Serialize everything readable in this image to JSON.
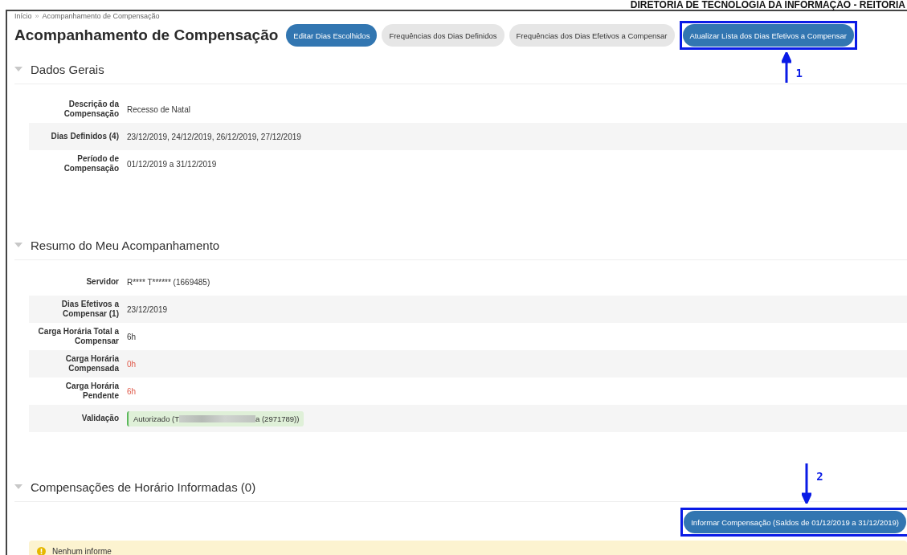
{
  "header": {
    "title": "DIRETORIA DE TECNOLOGIA DA INFORMAÇÃO - REITORIA"
  },
  "breadcrumb": [
    "Início",
    "»",
    "Acompanhamento de Compensação"
  ],
  "page_title": "Acompanhamento de Compensação",
  "actions": [
    {
      "label": "Editar Dias Escolhidos",
      "kind": "primary"
    },
    {
      "label": "Frequências dos Dias Definidos",
      "kind": "default"
    },
    {
      "label": "Frequências dos Dias Efetivos a Compensar",
      "kind": "default"
    },
    {
      "label": "Atualizar Lista dos Dias Efetivos a Compensar",
      "kind": "primary",
      "annotation": {
        "number": "1"
      }
    }
  ],
  "sections": [
    {
      "title": "Dados Gerais",
      "expanded": true,
      "rows": [
        {
          "label": "Descrição da Compensação",
          "value": "Recesso de Natal",
          "kind": "text"
        },
        {
          "label": "Dias Definidos (4)",
          "value": "23/12/2019, 24/12/2019, 26/12/2019, 27/12/2019",
          "kind": "text"
        },
        {
          "label": "Período de Compensação",
          "value": "01/12/2019 a 31/12/2019",
          "kind": "text"
        }
      ]
    },
    {
      "title": "Resumo do Meu Acompanhamento",
      "expanded": true,
      "rows": [
        {
          "label": "Servidor",
          "value": "R**** T****** (1669485)",
          "kind": "text"
        },
        {
          "label": "Dias Efetivos a Compensar (1)",
          "value": "23/12/2019",
          "kind": "text"
        },
        {
          "label": "Carga Horária Total a Compensar",
          "value": "6h",
          "kind": "text"
        },
        {
          "label": "Carga Horária Compensada",
          "value": "0h",
          "kind": "alert"
        },
        {
          "label": "Carga Horária Pendente",
          "value": "6h",
          "kind": "alert"
        },
        {
          "label": "Validação",
          "value": "Autorizado (T",
          "value_end": "a (2971789))",
          "kind": "validation"
        }
      ]
    },
    {
      "title": "Compensações de Horário Informadas (0)",
      "expanded": true,
      "action": {
        "label": "Informar Compensação (Saldos de 01/12/2019 a 31/12/2019)",
        "kind": "primary",
        "annotation": {
          "number": "2"
        }
      },
      "notice": "Nenhum informe"
    }
  ]
}
